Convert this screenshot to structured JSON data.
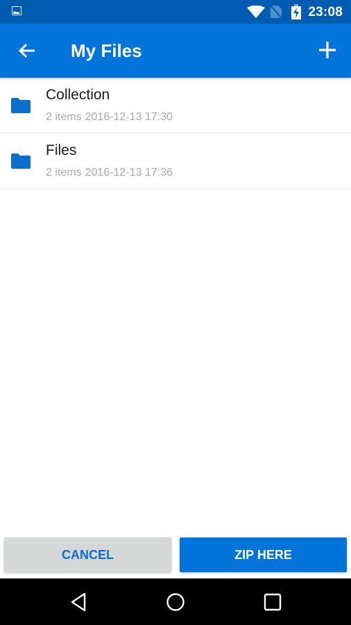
{
  "status_bar": {
    "time": "23:08",
    "icons": [
      "image-notification-icon",
      "wifi-icon",
      "no-sim-icon",
      "battery-charging-icon"
    ]
  },
  "app_bar": {
    "title": "My Files",
    "back_icon": "arrow-left-icon",
    "add_icon": "plus-icon"
  },
  "files": [
    {
      "name": "Collection",
      "count": "2 items",
      "date": "2016-12-13 17:30",
      "icon": "folder-icon"
    },
    {
      "name": "Files",
      "count": "2 items",
      "date": "2016-12-13 17:36",
      "icon": "folder-icon"
    }
  ],
  "actions": {
    "cancel_label": "CANCEL",
    "zip_label": "ZIP HERE"
  },
  "nav_bar": {
    "icons": [
      "back-triangle-icon",
      "home-circle-icon",
      "recents-square-icon"
    ]
  },
  "colors": {
    "primary": "#0074d8",
    "primary_dark": "#005cb0",
    "secondary_text": "#a8a8a8"
  }
}
